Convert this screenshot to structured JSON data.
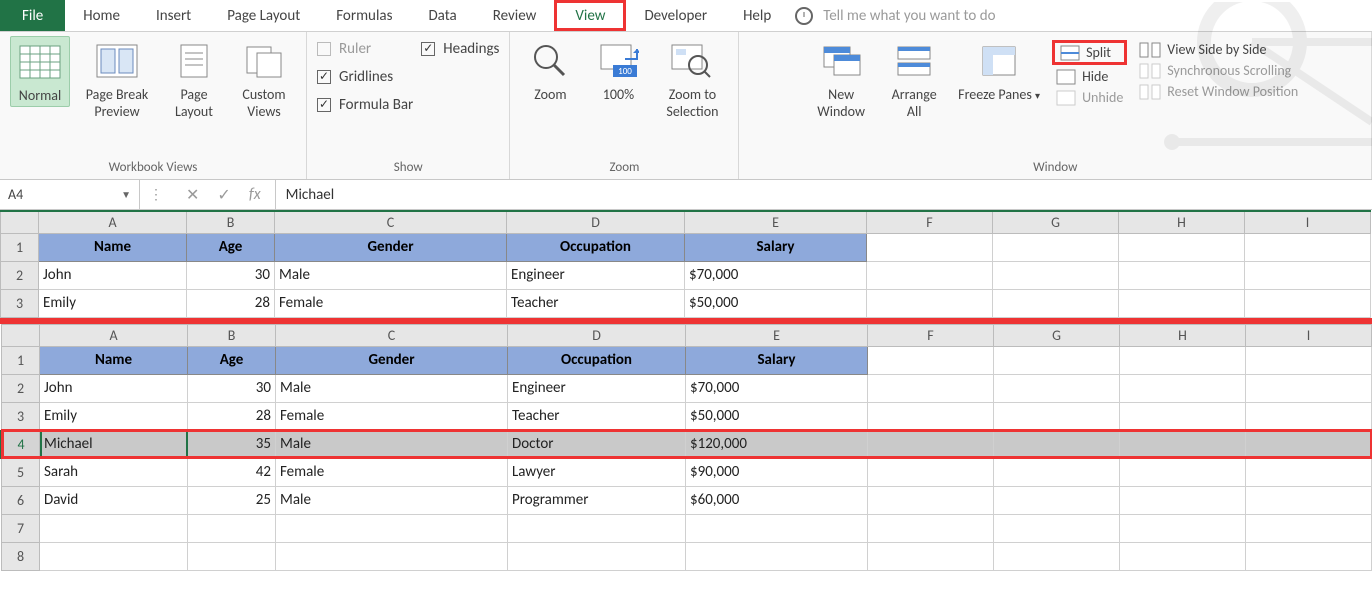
{
  "tabs": {
    "file": "File",
    "items": [
      "Home",
      "Insert",
      "Page Layout",
      "Formulas",
      "Data",
      "Review",
      "View",
      "Developer",
      "Help"
    ],
    "active": "View",
    "tell": "Tell me what you want to do"
  },
  "ribbon": {
    "workbook_views": {
      "label": "Workbook Views",
      "normal": "Normal",
      "page_break": "Page Break Preview",
      "page_layout": "Page Layout",
      "custom": "Custom Views"
    },
    "show": {
      "label": "Show",
      "ruler": "Ruler",
      "gridlines": "Gridlines",
      "formula_bar": "Formula Bar",
      "headings": "Headings"
    },
    "zoom": {
      "label": "Zoom",
      "zoom": "Zoom",
      "hundred": "100%",
      "selection": "Zoom to Selection"
    },
    "window": {
      "label": "Window",
      "new_window": "New Window",
      "arrange": "Arrange All",
      "freeze": "Freeze Panes",
      "split": "Split",
      "hide": "Hide",
      "unhide": "Unhide",
      "side": "View Side by Side",
      "sync": "Synchronous Scrolling",
      "reset": "Reset Window Position"
    }
  },
  "formula_bar": {
    "name_box": "A4",
    "fx": "fx",
    "value": "Michael"
  },
  "columns": [
    "A",
    "B",
    "C",
    "D",
    "E",
    "F",
    "G",
    "H",
    "I"
  ],
  "headers": {
    "name": "Name",
    "age": "Age",
    "gender": "Gender",
    "occupation": "Occupation",
    "salary": "Salary"
  },
  "data": [
    {
      "name": "John",
      "age": 30,
      "gender": "Male",
      "occupation": "Engineer",
      "salary": "$70,000"
    },
    {
      "name": "Emily",
      "age": 28,
      "gender": "Female",
      "occupation": "Teacher",
      "salary": "$50,000"
    },
    {
      "name": "Michael",
      "age": 35,
      "gender": "Male",
      "occupation": "Doctor",
      "salary": "$120,000"
    },
    {
      "name": "Sarah",
      "age": 42,
      "gender": "Female",
      "occupation": "Lawyer",
      "salary": "$90,000"
    },
    {
      "name": "David",
      "age": 25,
      "gender": "Male",
      "occupation": "Programmer",
      "salary": "$60,000"
    }
  ],
  "selected_row": 4,
  "chart_data": {
    "type": "table",
    "columns": [
      "Name",
      "Age",
      "Gender",
      "Occupation",
      "Salary"
    ],
    "rows": [
      [
        "John",
        30,
        "Male",
        "Engineer",
        "$70,000"
      ],
      [
        "Emily",
        28,
        "Female",
        "Teacher",
        "$50,000"
      ],
      [
        "Michael",
        35,
        "Male",
        "Doctor",
        "$120,000"
      ],
      [
        "Sarah",
        42,
        "Female",
        "Lawyer",
        "$90,000"
      ],
      [
        "David",
        25,
        "Male",
        "Programmer",
        "$60,000"
      ]
    ]
  }
}
